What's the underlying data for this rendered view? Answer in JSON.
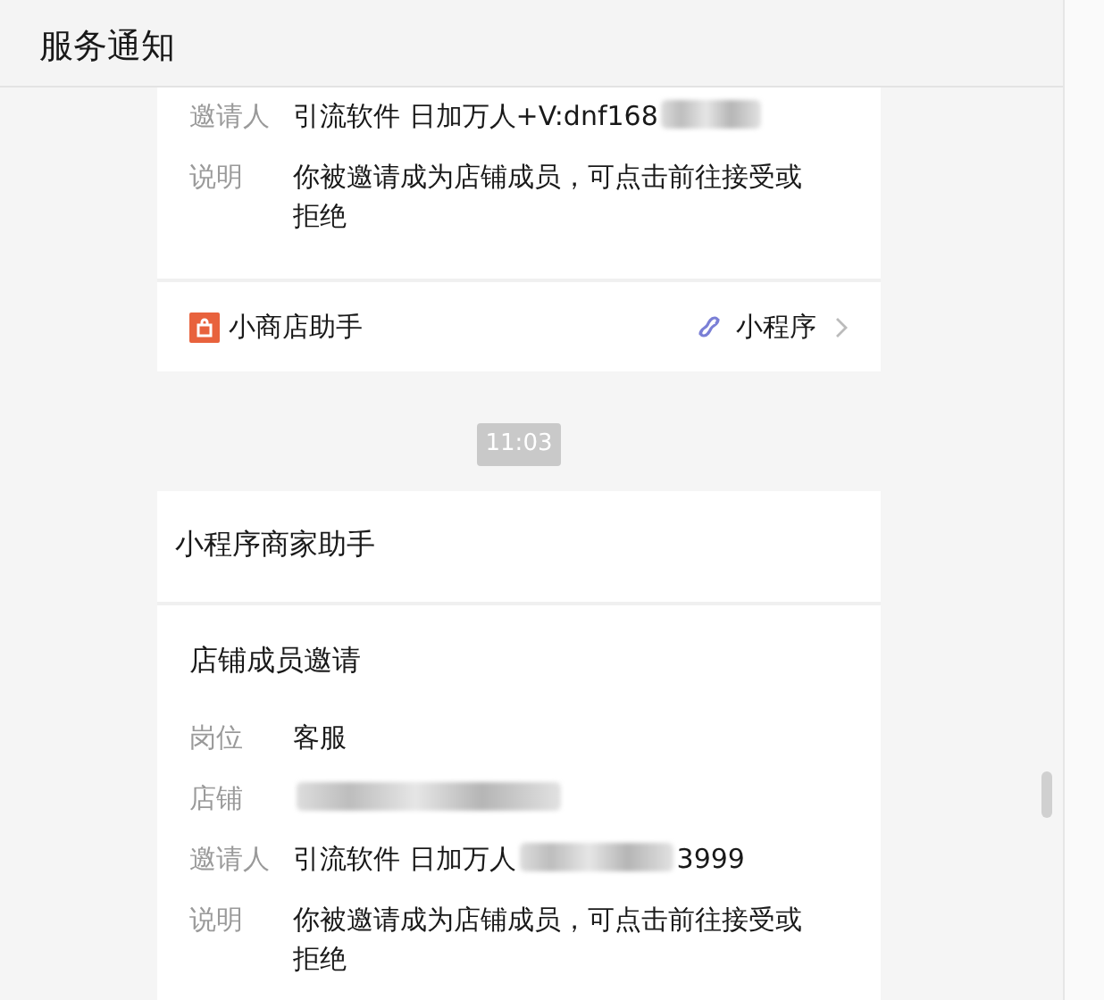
{
  "header": {
    "title": "服务通知"
  },
  "messages": [
    {
      "kind": "card",
      "fields": [
        {
          "label": "邀请人",
          "parts": [
            {
              "kind": "text",
              "text": "引流软件 日加万人+V:dnf168"
            },
            {
              "kind": "redacted"
            }
          ]
        },
        {
          "label": "说明",
          "parts": [
            {
              "kind": "text",
              "text": "你被邀请成为店铺成员，可点击前往接受或拒绝"
            }
          ]
        }
      ],
      "footer": {
        "app": "小商店助手",
        "type": "小程序"
      }
    },
    {
      "kind": "time",
      "text": "11:03"
    },
    {
      "kind": "card",
      "sender": "小程序商家助手",
      "heading": "店铺成员邀请",
      "fields": [
        {
          "label": "岗位",
          "parts": [
            {
              "kind": "text",
              "text": "客服"
            }
          ]
        },
        {
          "label": "店铺",
          "parts": [
            {
              "kind": "redacted"
            }
          ]
        },
        {
          "label": "邀请人",
          "parts": [
            {
              "kind": "text",
              "text": "引流软件 日加万人"
            },
            {
              "kind": "redacted"
            },
            {
              "kind": "text",
              "text": "3999"
            }
          ]
        },
        {
          "label": "说明",
          "parts": [
            {
              "kind": "text",
              "text": "你被邀请成为店铺成员，可点击前往接受或拒绝"
            }
          ]
        }
      ]
    }
  ]
}
